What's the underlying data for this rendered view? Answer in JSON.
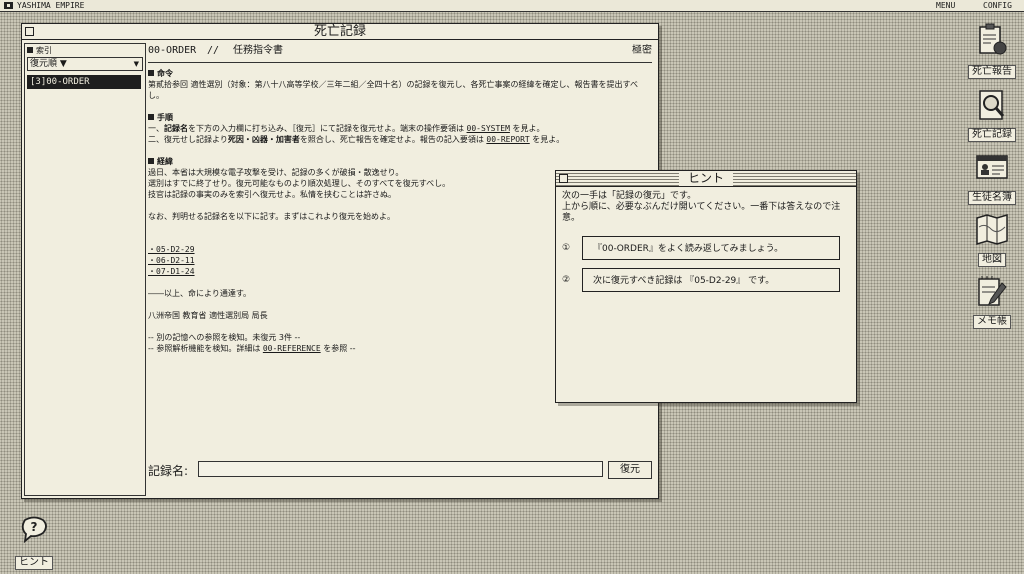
{
  "menubar": {
    "title": "YASHIMA EMPIRE",
    "menu": "MENU",
    "config": "CONFIG"
  },
  "main_window": {
    "title": "死亡記録",
    "index_panel": {
      "header": "索引",
      "sort_label": "復元順 ▼",
      "items": [
        "[3]00-ORDER"
      ]
    },
    "document": {
      "code": "00-ORDER",
      "separator": "//",
      "title": "任務指令書",
      "classification": "極密",
      "sec1_heading": "命令",
      "sec1_text": "第貳拾参回 適性選別（対象：第八十八高等学校／三年二組／全四十名）の記録を復元し、各死亡事案の経緯を確定し、報告書を提出すべし。",
      "sec2_heading": "手順",
      "step1_a": "一、",
      "step1_b": "記録名",
      "step1_c": "を下方の入力欄に打ち込み、［復元］にて記録を復元せよ。端末の操作要領は ",
      "step1_link": "00-SYSTEM",
      "step1_d": " を見よ。",
      "step2_a": "二、復元せし記録より",
      "step2_b": "死因・凶器・加害者",
      "step2_c": "を照合し、死亡報告を確定せよ。報告の記入要領は ",
      "step2_link": "00-REPORT",
      "step2_d": " を見よ。",
      "sec3_heading": "経緯",
      "history_1": "過日、本省は大規模な電子攻撃を受け、記録の多くが破損・散逸せり。",
      "history_2": "選別はすでに終了せり。復元可能なものより順次処理し、そのすべてを復元すべし。",
      "history_3": "技官は記録の事実のみを索引へ復元せよ。私情を挟むことは許さぬ。",
      "lead_in": "なお、判明せる記録名を以下に記す。まずはこれより復元を始めよ。",
      "records": [
        "・05-D2-29",
        "・06-D2-11",
        "・07-D1-24"
      ],
      "closing": "――以上、命により通達す。",
      "signature": "八洲帝国 教育省 適性選別局 局長",
      "note1": "-- 別の記憶への参照を検知。未復元 3件 --",
      "note2_a": "-- 参照解析機能を検知。詳細は ",
      "note2_link": "00-REFERENCE",
      "note2_b": " を参照 --"
    },
    "input": {
      "label": "記録名:",
      "value": "",
      "placeholder": ""
    },
    "restore_button": "復元"
  },
  "hint_window": {
    "title": "ヒント",
    "intro_1": "次の一手は「記録の復元」です。",
    "intro_2": "上から順に、必要なぶんだけ開いてください。一番下は答えなので注意。",
    "hints": [
      {
        "num": "①",
        "text": "『00-ORDER』をよく読み返してみましょう。"
      },
      {
        "num": "②",
        "text": "次に復元すべき記録は 『05-D2-29』 です。"
      }
    ]
  },
  "desktop_icons": {
    "death_report": "死亡報告",
    "death_record": "死亡記録",
    "roster": "生徒名簿",
    "map": "地図",
    "memo": "メモ帳",
    "hint": "ヒント"
  },
  "colors": {
    "window_bg": "#f1eedf",
    "desktop_bg": "#c9c6b6",
    "ink": "#1a1a1a"
  }
}
